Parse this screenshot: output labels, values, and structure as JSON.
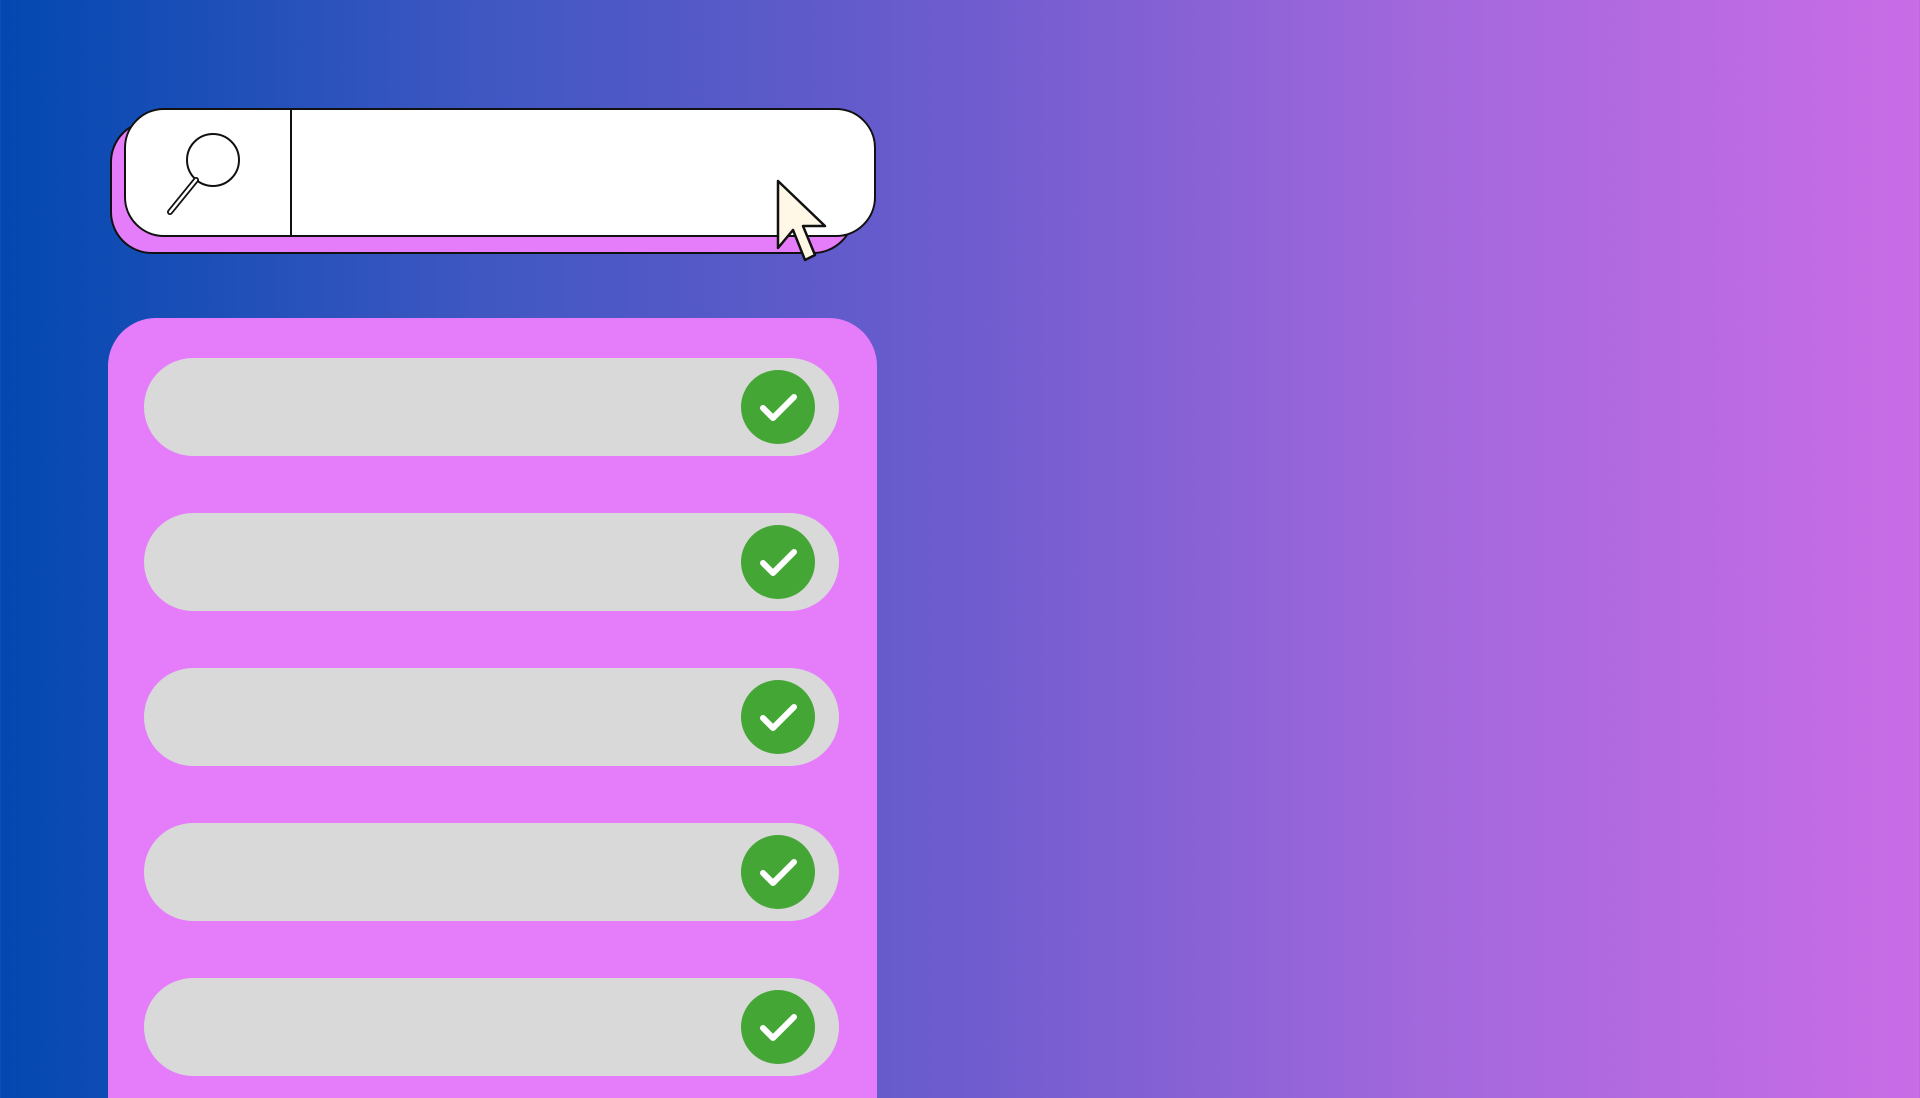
{
  "search": {
    "value": "",
    "placeholder": "",
    "icon": "search-icon"
  },
  "cursor": {
    "icon": "mouse-pointer-icon"
  },
  "checklist": {
    "items": [
      {
        "label": "",
        "status_icon": "check-circle-icon"
      },
      {
        "label": "",
        "status_icon": "check-circle-icon"
      },
      {
        "label": "",
        "status_icon": "check-circle-icon"
      },
      {
        "label": "",
        "status_icon": "check-circle-icon"
      },
      {
        "label": "",
        "status_icon": "check-circle-icon"
      }
    ]
  },
  "colors": {
    "background_start": "#0248B0",
    "background_end": "#C96CE6",
    "panel": "#E57DFB",
    "item": "#D9D9D9",
    "check": "#44A635",
    "cursor_fill": "#FFF8E6"
  }
}
